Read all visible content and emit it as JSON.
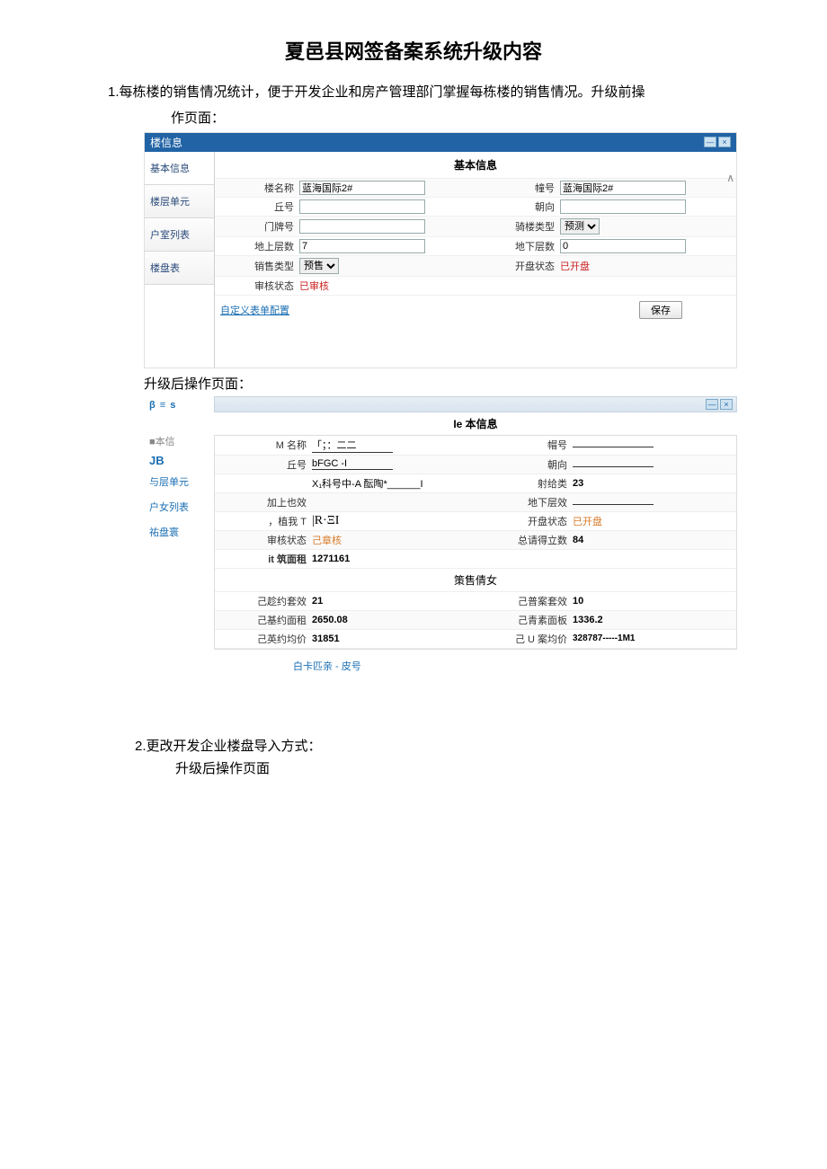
{
  "doc": {
    "title": "夏邑县网签备案系统升级内容",
    "p1": "1.每栋楼的销售情况统计，便于开发企业和房产管理部门掌握每栋楼的销售情况。升级前操",
    "p1b": "作页面：",
    "caption_after": "升级后操作页面：",
    "section2": "2.更改开发企业楼盘导入方式：",
    "section2_sub": "升级后操作页面"
  },
  "before": {
    "window_title": "楼信息",
    "section": "基本信息",
    "sidebar": [
      "基本信息",
      "楼层单元",
      "户室列表",
      "楼盘表"
    ],
    "rows": [
      {
        "l1": "楼名称",
        "v1": "蓝海国际2#",
        "l2": "幢号",
        "v2": "蓝海国际2#"
      },
      {
        "l1": "丘号",
        "v1": "",
        "l2": "朝向",
        "v2": ""
      },
      {
        "l1": "门牌号",
        "v1": "",
        "l2": "骑楼类型",
        "v2_select": "预测"
      },
      {
        "l1": "地上层数",
        "v1": "7",
        "l2": "地下层数",
        "v2": "0"
      },
      {
        "l1": "销售类型",
        "v1_select": "预售",
        "l2": "开盘状态",
        "v2_status": "已开盘"
      },
      {
        "l1": "审核状态",
        "v1_status": "已审核"
      }
    ],
    "save": "保存",
    "link": "自定义表单配置"
  },
  "after": {
    "header_left": "β ≡ s",
    "sidebar": {
      "line1": "■本信",
      "bold": "JB",
      "links": [
        "与层单元",
        "户女列表",
        "祐盘寰"
      ]
    },
    "section_title": "Ie 本信息",
    "rows_top": [
      {
        "l1": "M 名称",
        "v1": "「；：二二",
        "l2": "帽号",
        "v2": ""
      },
      {
        "l1": "丘号",
        "v1": "bFGC               -I",
        "l2": "朝向",
        "v2": ""
      },
      {
        "l1": "",
        "v1": "X₁科号中-A 酝陶*______I",
        "l2": "射给类",
        "v2b": "23"
      },
      {
        "l1": "加上也效",
        "v1": "",
        "l2": "地下层效",
        "v2": ""
      },
      {
        "l1": "，植我 T",
        "v1": "|R·ΞI",
        "l2": "开盘状态",
        "v2_status": "已开盘"
      },
      {
        "l1": "审核状态",
        "v1_status": "己章核",
        "l2": "总请得立数",
        "v2b": "84"
      },
      {
        "l1_b": "it 筑面租",
        "v1b": "1271161"
      }
    ],
    "sales_title": "策售倩女",
    "sales_rows": [
      {
        "l1": "己趁约套效",
        "v1": "21",
        "l2": "己普案套效",
        "v2": "10"
      },
      {
        "l1": "己基约面租",
        "v1": "2650.08",
        "l2": "己青素面板",
        "v2": "1336.2"
      },
      {
        "l1": "己英约均价",
        "v1": "31851",
        "l2": "己 U 案均价",
        "v2": "328787-----1M1"
      }
    ],
    "footer_link": "白卡匹亲 - 皮号"
  }
}
